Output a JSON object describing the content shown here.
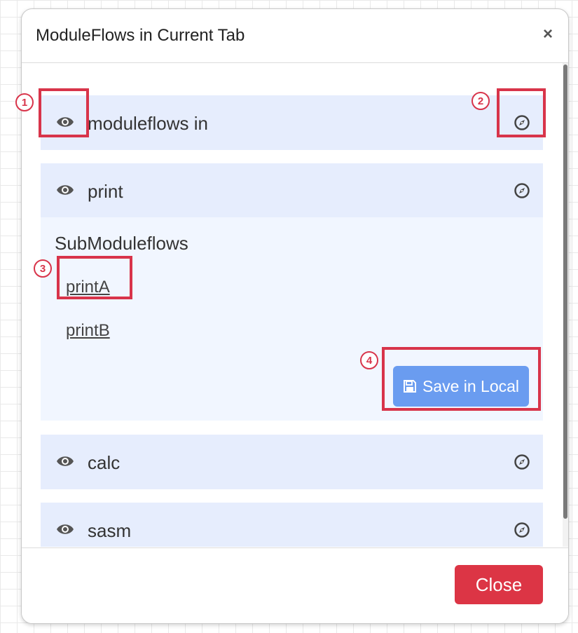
{
  "modal": {
    "title": "ModuleFlows in Current Tab",
    "close_icon": "×",
    "close_button_label": "Close"
  },
  "flows": [
    {
      "name": "moduleflows in",
      "view_icon": "eye-icon",
      "action_icon": "compass-icon"
    },
    {
      "name": "print",
      "view_icon": "eye-icon",
      "action_icon": "compass-icon"
    },
    {
      "name": "calc",
      "view_icon": "eye-icon",
      "action_icon": "compass-icon"
    },
    {
      "name": "sasm",
      "view_icon": "eye-icon",
      "action_icon": "compass-icon"
    }
  ],
  "submodule_panel": {
    "title": "SubModuleflows",
    "links": [
      "printA",
      "printB"
    ],
    "save_button_label": "Save in Local",
    "save_icon": "floppy-disk-icon"
  },
  "annotations": {
    "markers": [
      "1",
      "2",
      "3",
      "4"
    ]
  },
  "colors": {
    "row_background": "#e6edfd",
    "panel_background": "#f1f6ff",
    "save_button": "#6a9cf0",
    "close_button": "#dc3545",
    "annotation": "#d8344a"
  }
}
